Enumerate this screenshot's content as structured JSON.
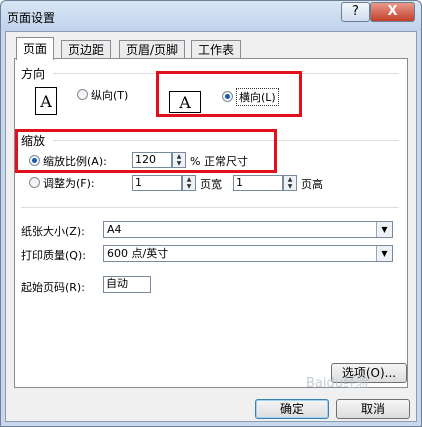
{
  "window": {
    "title": "页面设置",
    "help_glyph": "?",
    "close_glyph": "X"
  },
  "tabs": [
    "页面",
    "页边距",
    "页眉/页脚",
    "工作表"
  ],
  "orientation": {
    "section_title": "方向",
    "portrait_label": "纵向(T)",
    "landscape_label": "横向(L)",
    "selected": "landscape",
    "icon_glyph": "A"
  },
  "scaling": {
    "section_title": "缩放",
    "adjust_to_label": "缩放比例(A):",
    "adjust_to_value": "120",
    "percent_suffix": "% 正常尺寸",
    "fit_to_label": "调整为(F):",
    "fit_wide_value": "1",
    "fit_wide_suffix": "页宽",
    "fit_tall_value": "1",
    "fit_tall_suffix": "页高",
    "selected": "adjust_to"
  },
  "paper": {
    "paper_size_label": "纸张大小(Z):",
    "paper_size_value": "A4",
    "print_quality_label": "打印质量(Q):",
    "print_quality_value": "600 点/英寸",
    "first_page_label": "起始页码(R):",
    "first_page_value": "自动"
  },
  "buttons": {
    "options": "选项(O)...",
    "ok": "确定",
    "cancel": "取消"
  },
  "watermark": "Baidu经验"
}
